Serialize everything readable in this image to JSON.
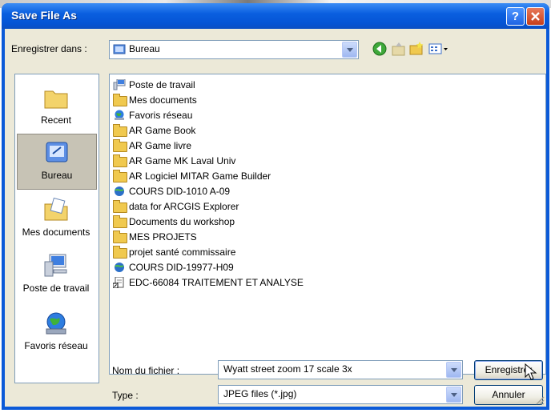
{
  "window": {
    "title": "Save File As"
  },
  "save_in": {
    "label": "Enregistrer dans :",
    "value": "Bureau"
  },
  "places": [
    {
      "label": "Recent",
      "icon": "recent-folder-icon"
    },
    {
      "label": "Bureau",
      "icon": "desktop-icon"
    },
    {
      "label": "Mes documents",
      "icon": "my-documents-icon"
    },
    {
      "label": "Poste de travail",
      "icon": "my-computer-icon"
    },
    {
      "label": "Favoris réseau",
      "icon": "network-places-icon"
    }
  ],
  "files": [
    {
      "name": "Poste de travail",
      "icon": "my-computer-icon"
    },
    {
      "name": "Mes documents",
      "icon": "my-documents-icon"
    },
    {
      "name": "Favoris réseau",
      "icon": "network-places-icon"
    },
    {
      "name": "AR Game Book",
      "icon": "folder-icon"
    },
    {
      "name": "AR Game livre",
      "icon": "folder-icon"
    },
    {
      "name": "AR Game MK Laval Univ",
      "icon": "folder-icon"
    },
    {
      "name": "AR Logiciel MITAR Game Builder",
      "icon": "folder-icon"
    },
    {
      "name": "COURS DID-1010 A-09",
      "icon": "globe-shortcut-icon"
    },
    {
      "name": "data for ARCGIS Explorer",
      "icon": "folder-icon"
    },
    {
      "name": "Documents du workshop",
      "icon": "folder-icon"
    },
    {
      "name": "MES PROJETS",
      "icon": "folder-icon"
    },
    {
      "name": "projet santé commissaire",
      "icon": "folder-icon"
    },
    {
      "name": "COURS DID-19977-H09",
      "icon": "globe-shortcut-icon"
    },
    {
      "name": "EDC-66084 TRAITEMENT ET ANALYSE",
      "icon": "document-shortcut-icon"
    }
  ],
  "filename": {
    "label": "Nom du fichier :",
    "value": "Wyatt street zoom 17 scale 3x"
  },
  "filetype": {
    "label": "Type :",
    "value": "JPEG files (*.jpg)"
  },
  "buttons": {
    "save": "Enregistrer",
    "cancel": "Annuler",
    "help": "?"
  },
  "colors": {
    "title_bar": "#0554d4",
    "dialog_bg": "#ece9d8",
    "close": "#c63f1a"
  }
}
